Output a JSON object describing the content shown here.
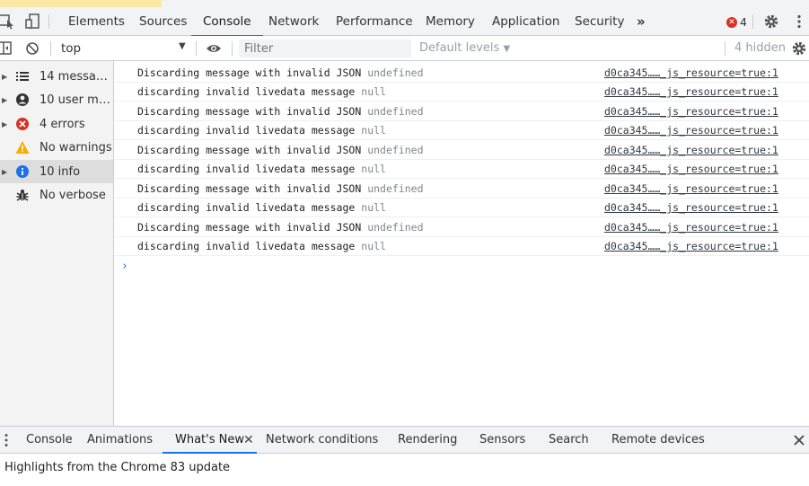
{
  "colors": {
    "accent": "#1a73e8",
    "error": "#d93025",
    "warning": "#f9ab00"
  },
  "tabs": [
    "Elements",
    "Sources",
    "Console",
    "Network",
    "Performance",
    "Memory",
    "Application",
    "Security"
  ],
  "active_tab": "Console",
  "error_count": "4",
  "toolbar": {
    "context": "top",
    "filter_placeholder": "Filter",
    "levels": "Default levels",
    "hidden": "4 hidden"
  },
  "sidebar": {
    "items": [
      {
        "label": "14 messages",
        "icon": "list-icon",
        "selected": false
      },
      {
        "label": "10 user messages",
        "icon": "user-icon",
        "selected": false
      },
      {
        "label": "4 errors",
        "icon": "error-icon",
        "selected": false
      },
      {
        "label": "No warnings",
        "icon": "warning-icon",
        "selected": false
      },
      {
        "label": "10 info",
        "icon": "info-icon",
        "selected": true
      },
      {
        "label": "No verbose",
        "icon": "bug-icon",
        "selected": false
      }
    ]
  },
  "messages": [
    {
      "text": "Discarding message with invalid JSON",
      "value": "undefined",
      "source": "d0ca345……_js_resource=true:1"
    },
    {
      "text": "discarding invalid livedata message",
      "value": "null",
      "source": "d0ca345……_js_resource=true:1"
    },
    {
      "text": "Discarding message with invalid JSON",
      "value": "undefined",
      "source": "d0ca345……_js_resource=true:1"
    },
    {
      "text": "discarding invalid livedata message",
      "value": "null",
      "source": "d0ca345……_js_resource=true:1"
    },
    {
      "text": "Discarding message with invalid JSON",
      "value": "undefined",
      "source": "d0ca345……_js_resource=true:1"
    },
    {
      "text": "discarding invalid livedata message",
      "value": "null",
      "source": "d0ca345……_js_resource=true:1"
    },
    {
      "text": "Discarding message with invalid JSON",
      "value": "undefined",
      "source": "d0ca345……_js_resource=true:1"
    },
    {
      "text": "discarding invalid livedata message",
      "value": "null",
      "source": "d0ca345……_js_resource=true:1"
    },
    {
      "text": "Discarding message with invalid JSON",
      "value": "undefined",
      "source": "d0ca345……_js_resource=true:1"
    },
    {
      "text": "discarding invalid livedata message",
      "value": "null",
      "source": "d0ca345……_js_resource=true:1"
    }
  ],
  "drawer": {
    "tabs": [
      "Console",
      "Animations",
      "What's New",
      "Network conditions",
      "Rendering",
      "Sensors",
      "Search",
      "Remote devices"
    ],
    "active_tab": "What's New",
    "content": "Highlights from the Chrome 83 update"
  }
}
